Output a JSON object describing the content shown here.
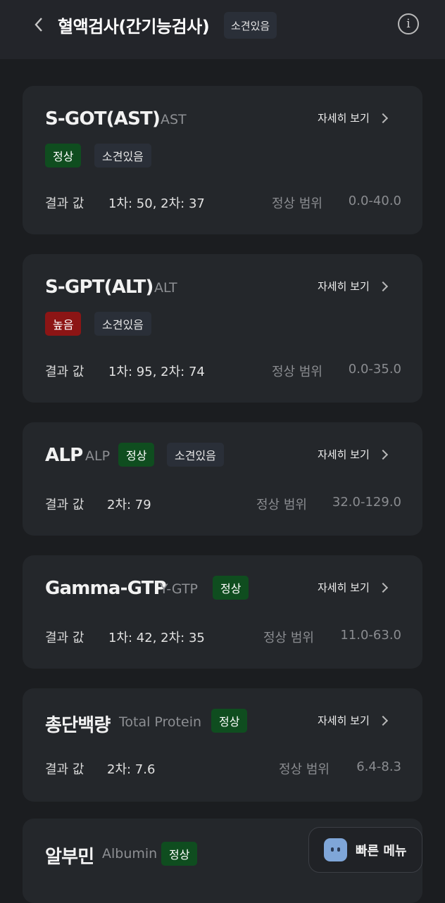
{
  "header": {
    "title": "혈액검사(간기능검사)",
    "badge": "소견있음",
    "info_icon": "info-icon",
    "back_icon": "chevron-left-icon"
  },
  "detail_label": "자세히 보기",
  "result_label": "결과 값",
  "range_label": "정상 범위",
  "cards": [
    {
      "name": "S-GOT(AST)",
      "sub": "AST",
      "status": "정상",
      "finding": "소견있음",
      "result": "1차: 50, 2차: 37",
      "range": "0.0-40.0"
    },
    {
      "name": "S-GPT(ALT)",
      "sub": "ALT",
      "status": "높음",
      "finding": "소견있음",
      "result": "1차: 95, 2차: 74",
      "range": "0.0-35.0"
    },
    {
      "name": "ALP",
      "sub": "ALP",
      "status": "정상",
      "finding": "소견있음",
      "result": "2차: 79",
      "range": "32.0-129.0"
    },
    {
      "name": "Gamma-GTP",
      "sub": "Y-GTP",
      "status": "정상",
      "result": "1차: 42, 2차: 35",
      "range": "11.0-63.0"
    },
    {
      "name": "총단백량",
      "sub": "Total Protein",
      "status": "정상",
      "result": "2차: 7.6",
      "range": "6.4-8.3"
    },
    {
      "name": "알부민",
      "sub": "Albumin",
      "status": "정상"
    }
  ],
  "quick_menu": {
    "label": "빠른 메뉴",
    "icon": "robot-icon"
  },
  "colors": {
    "normal": "#0f4d1f",
    "high": "#8c1515",
    "finding": "#2a2f38"
  }
}
